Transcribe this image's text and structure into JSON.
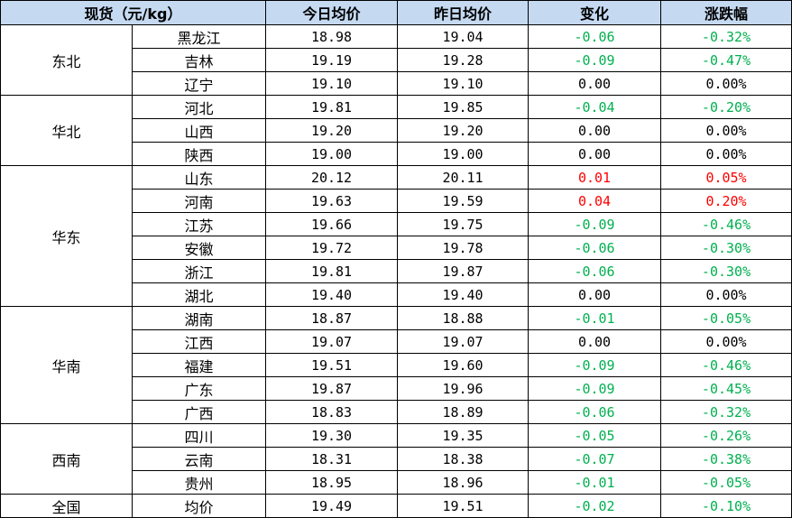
{
  "colors": {
    "header_bg": "#c5d9f1",
    "up": "#ff0000",
    "down": "#00b050",
    "flat": "#000000"
  },
  "headers": [
    "现货（元/kg）",
    "今日均价",
    "昨日均价",
    "变化",
    "涨跌幅"
  ],
  "groups": [
    {
      "region": "东北",
      "rows": [
        {
          "province": "黑龙江",
          "today": "18.98",
          "yesterday": "19.04",
          "change": "-0.06",
          "pct": "-0.32%",
          "trend": "down"
        },
        {
          "province": "吉林",
          "today": "19.19",
          "yesterday": "19.28",
          "change": "-0.09",
          "pct": "-0.47%",
          "trend": "down"
        },
        {
          "province": "辽宁",
          "today": "19.10",
          "yesterday": "19.10",
          "change": "0.00",
          "pct": "0.00%",
          "trend": "flat"
        }
      ]
    },
    {
      "region": "华北",
      "rows": [
        {
          "province": "河北",
          "today": "19.81",
          "yesterday": "19.85",
          "change": "-0.04",
          "pct": "-0.20%",
          "trend": "down"
        },
        {
          "province": "山西",
          "today": "19.20",
          "yesterday": "19.20",
          "change": "0.00",
          "pct": "0.00%",
          "trend": "flat"
        },
        {
          "province": "陕西",
          "today": "19.00",
          "yesterday": "19.00",
          "change": "0.00",
          "pct": "0.00%",
          "trend": "flat"
        }
      ]
    },
    {
      "region": "华东",
      "rows": [
        {
          "province": "山东",
          "today": "20.12",
          "yesterday": "20.11",
          "change": "0.01",
          "pct": "0.05%",
          "trend": "up"
        },
        {
          "province": "河南",
          "today": "19.63",
          "yesterday": "19.59",
          "change": "0.04",
          "pct": "0.20%",
          "trend": "up"
        },
        {
          "province": "江苏",
          "today": "19.66",
          "yesterday": "19.75",
          "change": "-0.09",
          "pct": "-0.46%",
          "trend": "down"
        },
        {
          "province": "安徽",
          "today": "19.72",
          "yesterday": "19.78",
          "change": "-0.06",
          "pct": "-0.30%",
          "trend": "down"
        },
        {
          "province": "浙江",
          "today": "19.81",
          "yesterday": "19.87",
          "change": "-0.06",
          "pct": "-0.30%",
          "trend": "down"
        },
        {
          "province": "湖北",
          "today": "19.40",
          "yesterday": "19.40",
          "change": "0.00",
          "pct": "0.00%",
          "trend": "flat"
        }
      ]
    },
    {
      "region": "华南",
      "rows": [
        {
          "province": "湖南",
          "today": "18.87",
          "yesterday": "18.88",
          "change": "-0.01",
          "pct": "-0.05%",
          "trend": "down"
        },
        {
          "province": "江西",
          "today": "19.07",
          "yesterday": "19.07",
          "change": "0.00",
          "pct": "0.00%",
          "trend": "flat"
        },
        {
          "province": "福建",
          "today": "19.51",
          "yesterday": "19.60",
          "change": "-0.09",
          "pct": "-0.46%",
          "trend": "down"
        },
        {
          "province": "广东",
          "today": "19.87",
          "yesterday": "19.96",
          "change": "-0.09",
          "pct": "-0.45%",
          "trend": "down"
        },
        {
          "province": "广西",
          "today": "18.83",
          "yesterday": "18.89",
          "change": "-0.06",
          "pct": "-0.32%",
          "trend": "down"
        }
      ]
    },
    {
      "region": "西南",
      "rows": [
        {
          "province": "四川",
          "today": "19.30",
          "yesterday": "19.35",
          "change": "-0.05",
          "pct": "-0.26%",
          "trend": "down"
        },
        {
          "province": "云南",
          "today": "18.31",
          "yesterday": "18.38",
          "change": "-0.07",
          "pct": "-0.38%",
          "trend": "down"
        },
        {
          "province": "贵州",
          "today": "18.95",
          "yesterday": "18.96",
          "change": "-0.01",
          "pct": "-0.05%",
          "trend": "down"
        }
      ]
    },
    {
      "region": "全国",
      "rows": [
        {
          "province": "均价",
          "today": "19.49",
          "yesterday": "19.51",
          "change": "-0.02",
          "pct": "-0.10%",
          "trend": "down"
        }
      ]
    }
  ]
}
